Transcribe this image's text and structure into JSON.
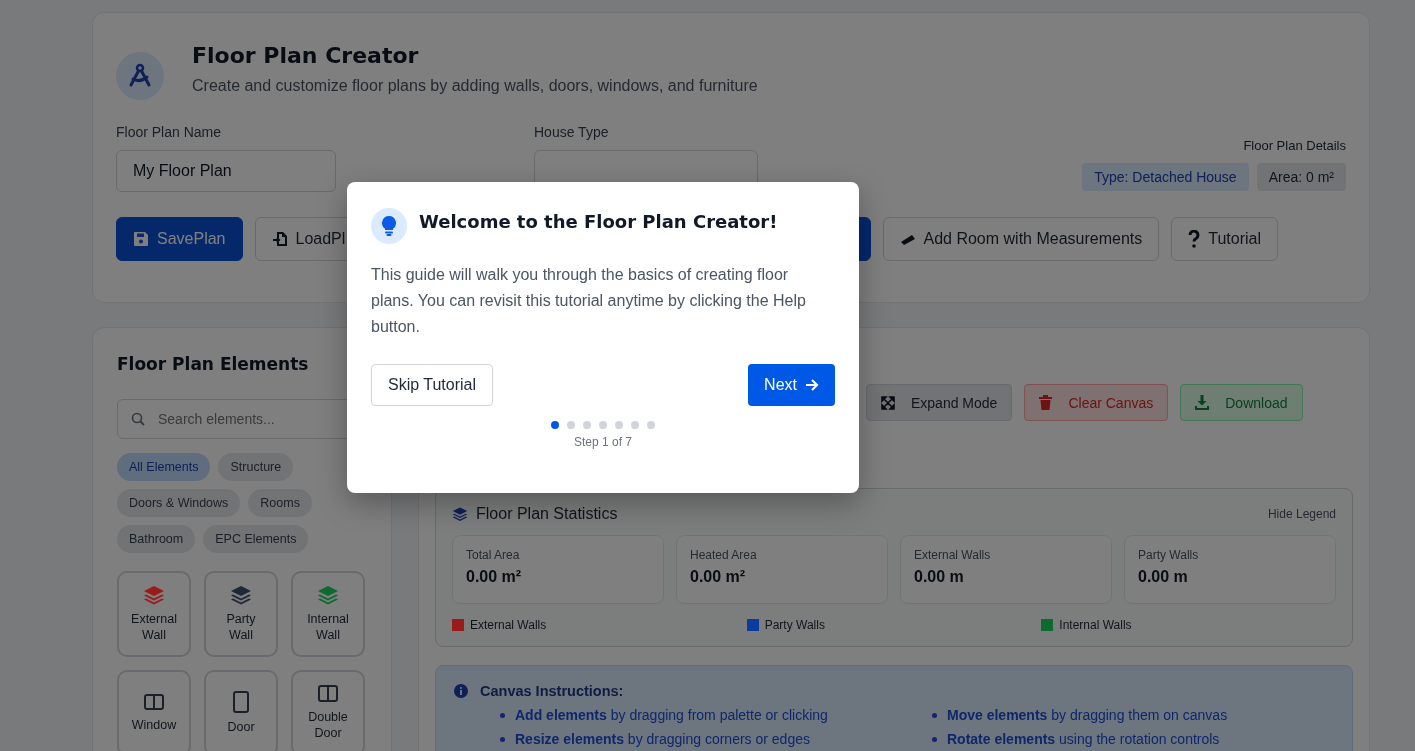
{
  "header": {
    "title": "Floor Plan Creator",
    "subtitle": "Create and customize floor plans by adding walls, doors, windows, and furniture"
  },
  "form": {
    "name_label": "Floor Plan Name",
    "name_value": "My Floor Plan",
    "house_type_label": "House Type"
  },
  "details": {
    "title": "Floor Plan Details",
    "badges": [
      {
        "kind": "type",
        "text": "Type: Detached House"
      },
      {
        "kind": "area",
        "text": "Area: 0 m²"
      }
    ]
  },
  "actions": [
    {
      "kind": "save",
      "label": "SavePlan"
    },
    {
      "kind": "load",
      "label": "LoadPl"
    },
    {
      "kind": "hidden"
    },
    {
      "kind": "measure",
      "label": "Add Room with Measurements"
    },
    {
      "kind": "help",
      "label": "Tutorial"
    }
  ],
  "elements_panel": {
    "title": "Floor Plan Elements",
    "search_placeholder": "Search elements...",
    "filters": [
      {
        "label": "All Elements",
        "selected": true
      },
      {
        "label": "Structure",
        "selected": false
      },
      {
        "label": "Doors & Windows",
        "selected": false
      },
      {
        "label": "Rooms",
        "selected": false
      },
      {
        "label": "Bathroom",
        "selected": false
      },
      {
        "label": "EPC Elements",
        "selected": false
      }
    ],
    "items": [
      {
        "kind": "wall",
        "label": "External Wall",
        "color": "#9b1a1a"
      },
      {
        "kind": "wall",
        "label": "Party Wall",
        "color": "#1f2937"
      },
      {
        "kind": "wall",
        "label": "Internal Wall",
        "color": "#0d6b30"
      },
      {
        "kind": "window",
        "label": "Window"
      },
      {
        "kind": "door",
        "label": "Door"
      },
      {
        "kind": "double-door",
        "label": "Double Door"
      }
    ]
  },
  "canvas_toolbar": [
    {
      "kind": "expand",
      "label": "Expand Mode"
    },
    {
      "kind": "clear",
      "label": "Clear Canvas"
    },
    {
      "kind": "download",
      "label": "Download"
    }
  ],
  "statistics": {
    "title": "Floor Plan Statistics",
    "toggle": "Hide Legend",
    "cards": [
      {
        "label": "Total Area",
        "value": "0.00 m²"
      },
      {
        "label": "Heated Area",
        "value": "0.00 m²"
      },
      {
        "label": "External Walls",
        "value": "0.00 m"
      },
      {
        "label": "Party Walls",
        "value": "0.00 m"
      }
    ],
    "legend": [
      {
        "label": "External Walls",
        "color": "#9b1a1a"
      },
      {
        "label": "Party Walls",
        "color": "#0b3b9e"
      },
      {
        "label": "Internal Walls",
        "color": "#0d6b30"
      }
    ]
  },
  "instructions": {
    "title": "Canvas Instructions:",
    "items": [
      "**Add elements** by dragging from palette or clicking",
      "**Move elements** by dragging them on canvas",
      "**Resize elements** by dragging corners or edges",
      "**Rotate elements** using the rotation controls"
    ]
  },
  "tutorial": {
    "title": "Welcome to the Floor Plan Creator!",
    "body": "This guide will walk you through the basics of creating floor plans. You can revisit this tutorial anytime by clicking the Help button.",
    "skip": "Skip Tutorial",
    "next": "Next",
    "steps": [
      {
        "selected": true
      },
      {
        "selected": false
      },
      {
        "selected": false
      },
      {
        "selected": false
      },
      {
        "selected": false
      },
      {
        "selected": false
      },
      {
        "selected": false
      }
    ],
    "step_text": "Step 1 of 7"
  }
}
